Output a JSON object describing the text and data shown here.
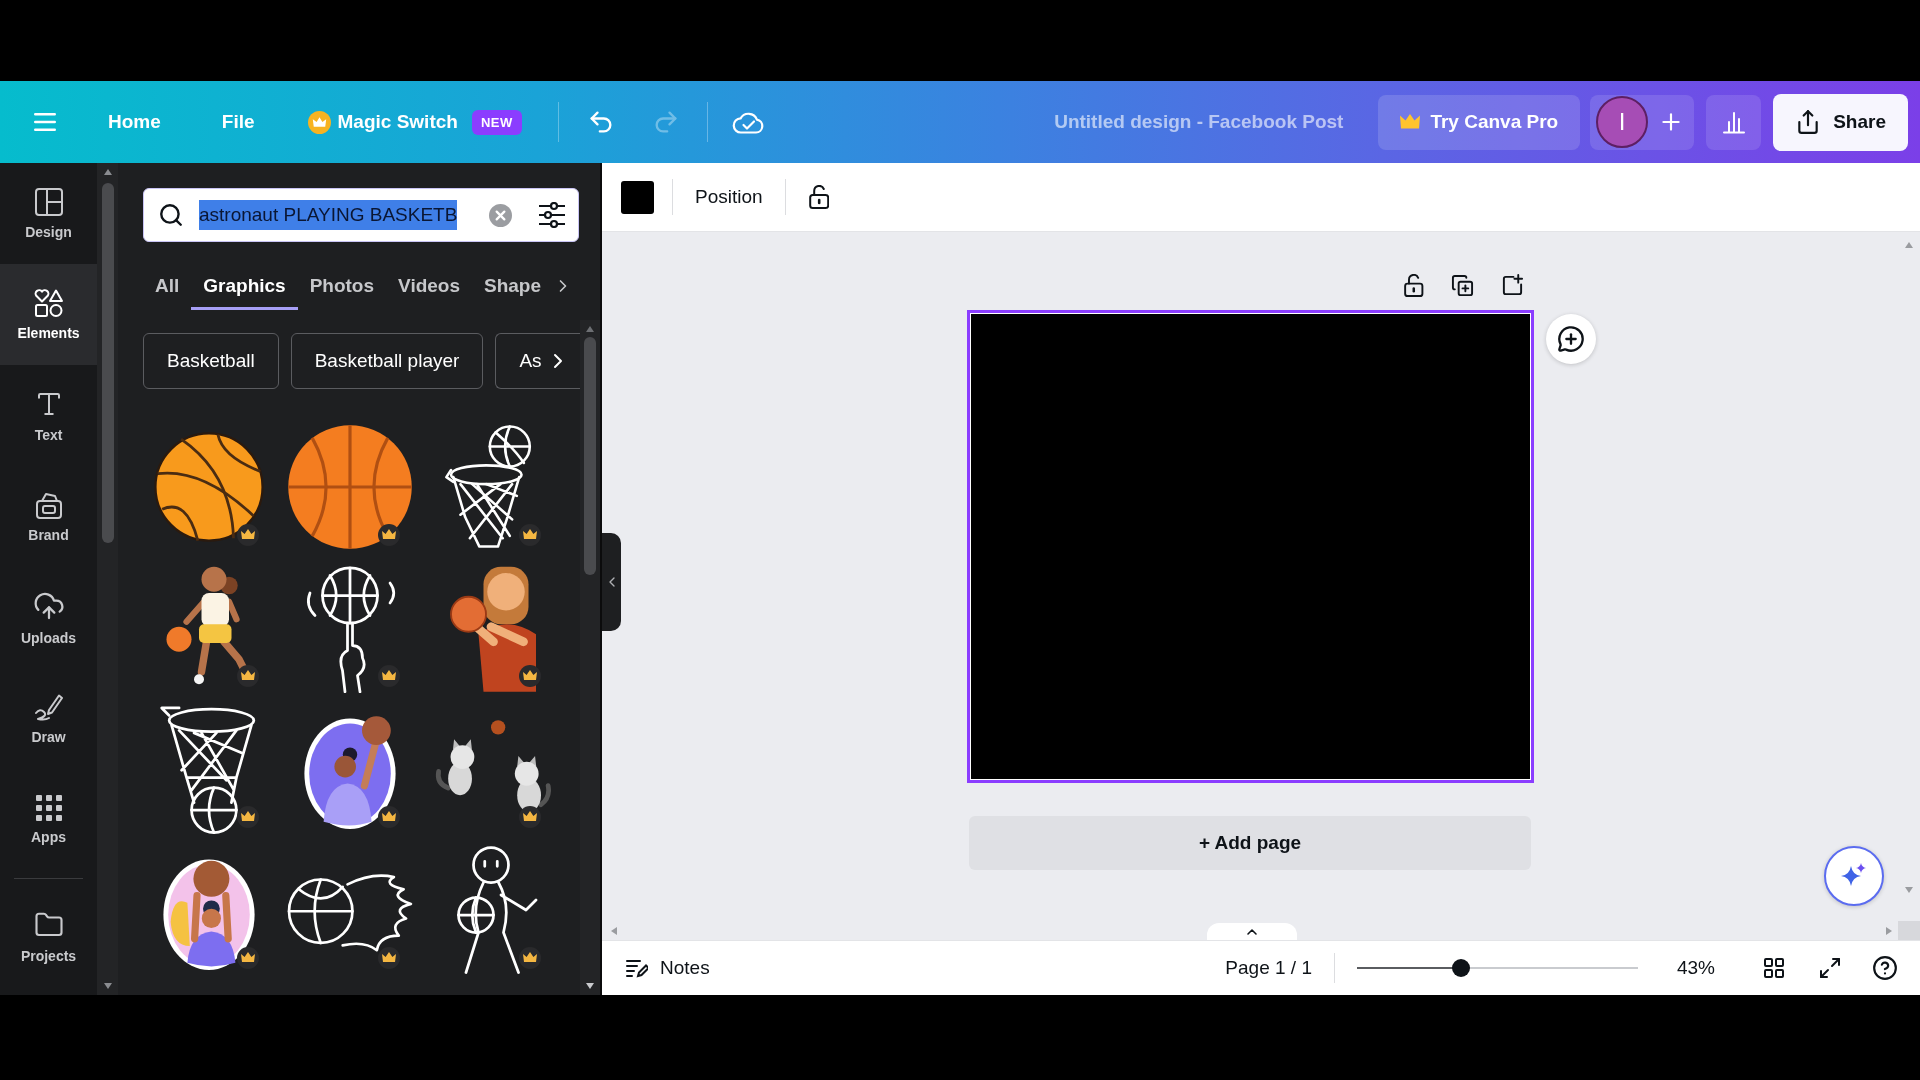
{
  "top_bar": {
    "nav": [
      {
        "label": "Home"
      },
      {
        "label": "File"
      }
    ],
    "magic_switch": {
      "label": "Magic Switch",
      "badge": "NEW"
    },
    "undo": {
      "disabled": false
    },
    "redo": {
      "disabled": true
    },
    "title": "Untitled design - Facebook Post",
    "pro_button": "Try Canva Pro",
    "avatar": "I",
    "share_button": "Share"
  },
  "sidebar": {
    "items": [
      {
        "label": "Design",
        "selected": false
      },
      {
        "label": "Elements",
        "selected": true
      },
      {
        "label": "Text",
        "selected": false
      },
      {
        "label": "Brand",
        "selected": false
      },
      {
        "label": "Uploads",
        "selected": false
      },
      {
        "label": "Draw",
        "selected": false
      },
      {
        "label": "Apps",
        "selected": false
      },
      {
        "label": "Projects",
        "selected": false
      }
    ]
  },
  "panel": {
    "search": {
      "value": "astronaut PLAYING BASKETB",
      "highlighted": true
    },
    "tabs": [
      {
        "label": "All",
        "selected": false
      },
      {
        "label": "Graphics",
        "selected": true
      },
      {
        "label": "Photos",
        "selected": false
      },
      {
        "label": "Videos",
        "selected": false
      },
      {
        "label": "Shape",
        "selected": false
      }
    ],
    "suggestions": [
      "Basketball",
      "Basketball player",
      "As"
    ],
    "graphics": [
      {
        "kind": "ball",
        "premium": true
      },
      {
        "kind": "flatball",
        "premium": true
      },
      {
        "kind": "hoopball",
        "premium": true
      },
      {
        "kind": "dribbler",
        "premium": true
      },
      {
        "kind": "spinball",
        "premium": true
      },
      {
        "kind": "shooter",
        "premium": true
      },
      {
        "kind": "net",
        "premium": true
      },
      {
        "kind": "sticker",
        "premium": true
      },
      {
        "kind": "raccoons",
        "premium": true
      },
      {
        "kind": "badge",
        "premium": true
      },
      {
        "kind": "fireball",
        "premium": true
      },
      {
        "kind": "runner",
        "premium": true
      }
    ]
  },
  "toolbar": {
    "position_button": "Position"
  },
  "canvas": {
    "page_selected": true,
    "add_page_button": "+ Add page"
  },
  "bottom_bar": {
    "notes_button": "Notes",
    "page_indicator": "Page 1 / 1",
    "zoom": {
      "level": 0.37
    },
    "zoom_reading": "43%"
  }
}
